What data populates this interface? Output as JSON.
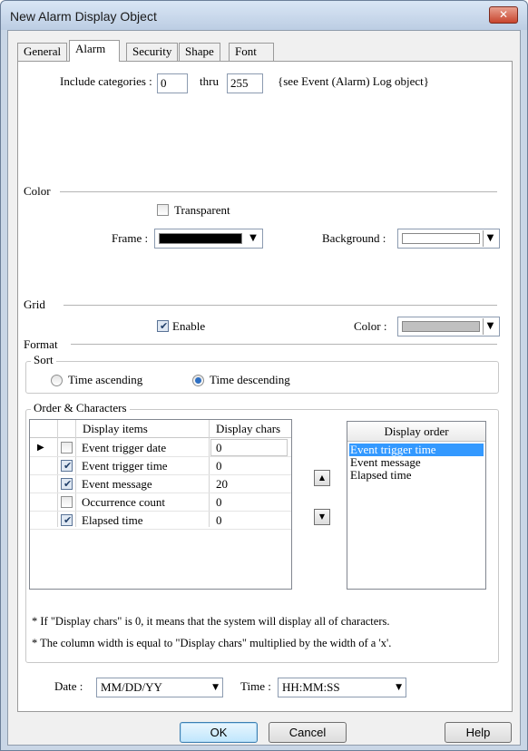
{
  "window": {
    "title": "New Alarm Display Object",
    "close_icon": "close-icon"
  },
  "tabs": [
    "General",
    "Alarm",
    "Security",
    "Shape",
    "Font"
  ],
  "active_tab": "Alarm",
  "categories": {
    "label": "Include categories :",
    "from": "0",
    "thru_label": "thru",
    "to": "255",
    "note": "{see Event (Alarm) Log object}"
  },
  "color": {
    "section": "Color",
    "transparent_label": "Transparent",
    "transparent_checked": false,
    "frame_label": "Frame :",
    "frame_color": "#000000",
    "background_label": "Background :",
    "background_color": "#ffffff"
  },
  "grid_section": {
    "section": "Grid",
    "enable_label": "Enable",
    "enable_checked": true,
    "color_label": "Color :",
    "grid_color": "#c0c0c0"
  },
  "format": {
    "section": "Format",
    "sort": {
      "label": "Sort",
      "ascending": "Time ascending",
      "descending": "Time descending",
      "selected": "Time descending"
    },
    "order": {
      "label": "Order & Characters",
      "columns": [
        "Display items",
        "Display chars"
      ],
      "rows": [
        {
          "item": "Event trigger date",
          "chars": "0",
          "checked": false
        },
        {
          "item": "Event trigger time",
          "chars": "0",
          "checked": true
        },
        {
          "item": "Event message",
          "chars": "20",
          "checked": true
        },
        {
          "item": "Occurrence count",
          "chars": "0",
          "checked": false
        },
        {
          "item": "Elapsed time",
          "chars": "0",
          "checked": true
        }
      ],
      "display_order_header": "Display order",
      "display_order": [
        "Event trigger time",
        "Event message",
        "Elapsed time"
      ],
      "selected_order": "Event trigger time",
      "note1": "* If \"Display chars\" is 0, it means that the system will display all of characters.",
      "note2": "* The column width is equal to \"Display chars\" multiplied by the width of a 'x'."
    }
  },
  "date": {
    "label": "Date :",
    "value": "MM/DD/YY"
  },
  "time": {
    "label": "Time :",
    "value": "HH:MM:SS"
  },
  "buttons": {
    "ok": "OK",
    "cancel": "Cancel",
    "help": "Help"
  }
}
